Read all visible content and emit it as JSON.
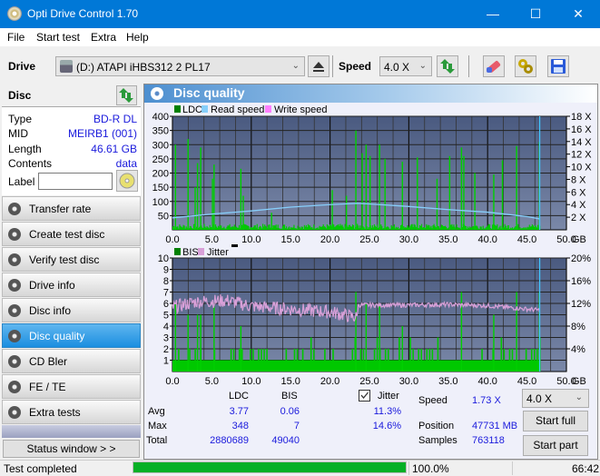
{
  "window": {
    "title": "Opti Drive Control 1.70",
    "minimize": "—",
    "maximize": "☐",
    "close": "✕"
  },
  "menu": [
    "File",
    "Start test",
    "Extra",
    "Help"
  ],
  "toolbar": {
    "drive_label": "Drive",
    "drive_value": "(D:)   ATAPI iHBS312   2 PL17",
    "speed_label": "Speed",
    "speed_value": "4.0 X"
  },
  "disc": {
    "header": "Disc",
    "rows": [
      {
        "label": "Type",
        "value": "BD-R DL"
      },
      {
        "label": "MID",
        "value": "MEIRB1 (001)"
      },
      {
        "label": "Length",
        "value": "46.61 GB"
      },
      {
        "label": "Contents",
        "value": "data"
      }
    ],
    "label_field": "Label",
    "label_value": ""
  },
  "nav": [
    {
      "label": "Transfer rate",
      "active": false
    },
    {
      "label": "Create test disc",
      "active": false
    },
    {
      "label": "Verify test disc",
      "active": false
    },
    {
      "label": "Drive info",
      "active": false
    },
    {
      "label": "Disc info",
      "active": false
    },
    {
      "label": "Disc quality",
      "active": true
    },
    {
      "label": "CD Bler",
      "active": false
    },
    {
      "label": "FE / TE",
      "active": false
    },
    {
      "label": "Extra tests",
      "active": false
    }
  ],
  "status_window_button": "Status window > >",
  "main_title": "Disc quality",
  "colors": {
    "ldc": "#00c000",
    "read_speed": "#7fd0ff",
    "write_speed": "#ff80ff",
    "bis": "#00c000",
    "jitter": "#d8a0d8",
    "plot_bg_top": "#4a5a80",
    "plot_bg_bottom": "#7a88a8"
  },
  "chart_data": [
    {
      "type": "bar",
      "title": "LDC / Read speed",
      "legend": [
        "LDC",
        "Read speed",
        "Write speed"
      ],
      "xlabel": "GB",
      "x_ticks": [
        "0.0",
        "5.0",
        "10.0",
        "15.0",
        "20.0",
        "25.0",
        "30.0",
        "35.0",
        "40.0",
        "45.0",
        "50.0"
      ],
      "xlim": [
        0,
        50
      ],
      "y_ticks_left": [
        "400",
        "350",
        "300",
        "250",
        "200",
        "150",
        "100",
        "50"
      ],
      "ylim_left": [
        0,
        400
      ],
      "y_ticks_right": [
        "18 X",
        "16 X",
        "14 X",
        "12 X",
        "10 X",
        "8 X",
        "6 X",
        "4 X",
        "2 X"
      ],
      "ylim_right": [
        0,
        18
      ],
      "end_marker_gb": 46.61,
      "ldc_spikes": [
        [
          0.3,
          300
        ],
        [
          1.9,
          320
        ],
        [
          2.8,
          150
        ],
        [
          3.1,
          235
        ],
        [
          3.5,
          290
        ],
        [
          5.2,
          230
        ],
        [
          5.0,
          180
        ],
        [
          8.6,
          215
        ],
        [
          8.9,
          120
        ],
        [
          12.5,
          60
        ],
        [
          20.2,
          140
        ],
        [
          22.0,
          120
        ],
        [
          23.2,
          350
        ],
        [
          24.0,
          270
        ],
        [
          24.5,
          300
        ],
        [
          25.0,
          260
        ],
        [
          26.2,
          300
        ],
        [
          26.9,
          250
        ],
        [
          29.1,
          240
        ],
        [
          31.0,
          255
        ],
        [
          33.5,
          180
        ],
        [
          35.1,
          260
        ],
        [
          36.6,
          290
        ],
        [
          36.9,
          260
        ],
        [
          38.3,
          200
        ],
        [
          40.7,
          195
        ],
        [
          41.8,
          245
        ],
        [
          43.6,
          295
        ],
        [
          46.5,
          310
        ]
      ],
      "ldc_avg": 3.77,
      "ldc_max": 348,
      "read_speed": [
        [
          0,
          1.9
        ],
        [
          5,
          2.5
        ],
        [
          10,
          3.0
        ],
        [
          15,
          3.6
        ],
        [
          20,
          4.0
        ],
        [
          23.5,
          4.2
        ],
        [
          25,
          4.1
        ],
        [
          30,
          3.7
        ],
        [
          35,
          3.2
        ],
        [
          40,
          2.8
        ],
        [
          45,
          2.1
        ],
        [
          46.6,
          1.73
        ]
      ]
    },
    {
      "type": "bar",
      "title": "BIS / Jitter",
      "legend": [
        "BIS",
        "Jitter"
      ],
      "xlabel": "GB",
      "x_ticks": [
        "0.0",
        "5.0",
        "10.0",
        "15.0",
        "20.0",
        "25.0",
        "30.0",
        "35.0",
        "40.0",
        "45.0",
        "50.0"
      ],
      "xlim": [
        0,
        50
      ],
      "y_ticks_left": [
        "10",
        "9",
        "8",
        "7",
        "6",
        "5",
        "4",
        "3",
        "2",
        "1"
      ],
      "ylim_left": [
        0,
        10
      ],
      "y_ticks_right": [
        "20%",
        "16%",
        "12%",
        "8%",
        "4%"
      ],
      "ylim_right": [
        0,
        20
      ],
      "end_marker_gb": 46.61,
      "bis_spikes": [
        [
          0.3,
          6
        ],
        [
          1.9,
          5
        ],
        [
          3.1,
          5
        ],
        [
          3.5,
          5
        ],
        [
          5.2,
          6
        ],
        [
          8.6,
          4
        ],
        [
          23.2,
          7
        ],
        [
          24.5,
          6
        ],
        [
          26.2,
          6
        ],
        [
          29.1,
          4
        ],
        [
          36.6,
          7
        ],
        [
          40.7,
          5
        ],
        [
          43.6,
          7
        ],
        [
          46.5,
          7
        ]
      ],
      "jitter": [
        [
          0,
          11.3
        ],
        [
          3,
          12.3
        ],
        [
          7,
          12.5
        ],
        [
          10,
          11.5
        ],
        [
          15,
          11.0
        ],
        [
          20,
          10.5
        ],
        [
          23.4,
          9.5
        ],
        [
          23.6,
          11.7
        ],
        [
          30,
          11.7
        ],
        [
          35,
          11.8
        ],
        [
          40,
          11.6
        ],
        [
          45,
          11.0
        ],
        [
          46.6,
          10.8
        ]
      ]
    }
  ],
  "stats": {
    "col_ldc": "LDC",
    "col_bis": "BIS",
    "jitter_label": "Jitter",
    "jitter_checked": true,
    "rows": [
      {
        "label": "Avg",
        "ldc": "3.77",
        "bis": "0.06",
        "jitter": "11.3%"
      },
      {
        "label": "Max",
        "ldc": "348",
        "bis": "7",
        "jitter": "14.6%"
      },
      {
        "label": "Total",
        "ldc": "2880689",
        "bis": "49040",
        "jitter": ""
      }
    ],
    "speed_label": "Speed",
    "speed_value": "1.73 X",
    "position_label": "Position",
    "position_value": "47731 MB",
    "samples_label": "Samples",
    "samples_value": "763118",
    "speed_select": "4.0 X",
    "start_full": "Start full",
    "start_part": "Start part"
  },
  "statusbar": {
    "text": "Test completed",
    "progress_percent": 100.0,
    "progress_label": "100.0%",
    "time": "66:42"
  }
}
